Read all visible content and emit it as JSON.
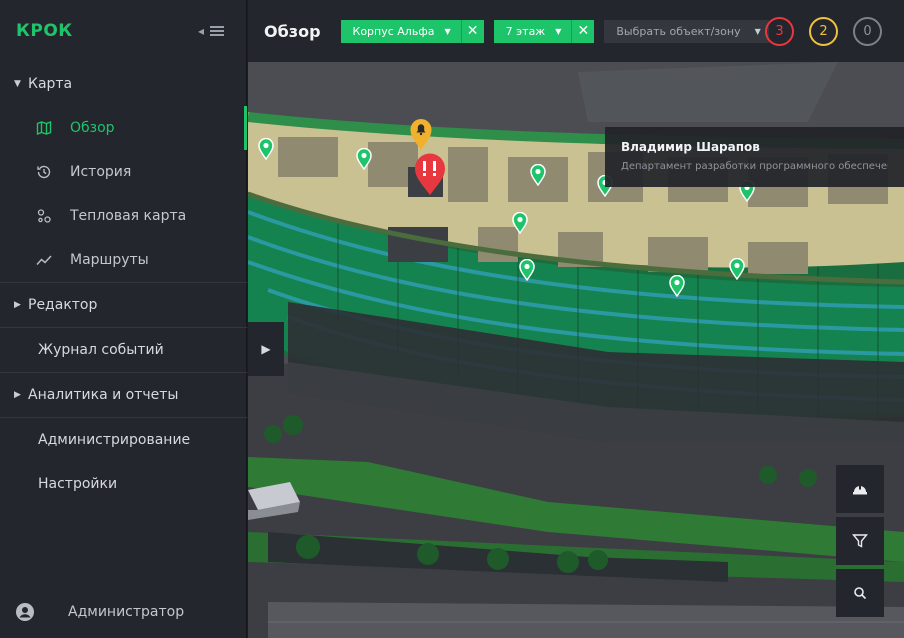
{
  "sidebar": {
    "logo": "КРОК",
    "sections": {
      "map": {
        "label": "Карта",
        "items": [
          {
            "label": "Обзор",
            "icon": "map-icon"
          },
          {
            "label": "История",
            "icon": "history-icon"
          },
          {
            "label": "Тепловая карта",
            "icon": "heatmap-icon"
          },
          {
            "label": "Маршруты",
            "icon": "route-icon"
          }
        ]
      },
      "editor": {
        "label": "Редактор"
      },
      "events": {
        "label": "Журнал событий"
      },
      "analytics": {
        "label": "Аналитика и отчеты"
      },
      "admin": {
        "label": "Администрирование"
      },
      "settings": {
        "label": "Настройки"
      }
    },
    "user": {
      "name": "Администратор",
      "icon": "user-avatar-icon"
    }
  },
  "topbar": {
    "title": "Обзор",
    "filters": [
      {
        "label": "Корпус Альфа"
      },
      {
        "label": "7 этаж"
      }
    ],
    "zone_select": {
      "placeholder": "Выбрать объект/зону"
    },
    "counters": {
      "critical": "3",
      "warning": "2",
      "info": "0"
    }
  },
  "map": {
    "tooltip": {
      "name": "Владимир Шарапов",
      "department": "Департамент разработки программного обеспечен..."
    },
    "pin_count": 9,
    "alerts": {
      "warning_icon": "bell-icon",
      "critical_icon": "exclamation-icon"
    },
    "controls": [
      "helmet-icon",
      "filter-icon",
      "search-icon"
    ]
  },
  "colors": {
    "accent": "#1ec46a",
    "critical": "#e8383f",
    "warning": "#f1c040",
    "sidebar_bg": "#23262c"
  }
}
